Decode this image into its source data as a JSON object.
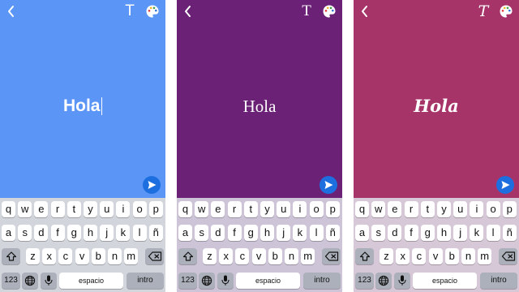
{
  "phones": [
    {
      "background": "#5b96f7",
      "keyboard_bg": "#d2d5dc",
      "font_icon": "T",
      "font_style": "sans",
      "text": "Hola",
      "show_caret": true
    },
    {
      "background": "#6b2276",
      "keyboard_bg": "#cec4d8",
      "font_icon": "T",
      "font_style": "serif",
      "text": "Hola",
      "show_caret": false
    },
    {
      "background": "#a63468",
      "keyboard_bg": "#d7c8d8",
      "font_icon": "T",
      "font_style": "script",
      "text": "Hola",
      "show_caret": false
    }
  ],
  "icons": {
    "back": "chevron-left-icon",
    "font": "text-style-icon",
    "palette": "palette-icon",
    "send": "send-arrow-icon",
    "shift": "shift-arrow-icon",
    "delete": "backspace-icon",
    "globe": "globe-icon",
    "mic": "microphone-icon"
  },
  "keyboard": {
    "row1": [
      "q",
      "w",
      "e",
      "r",
      "t",
      "y",
      "u",
      "i",
      "o",
      "p"
    ],
    "row2": [
      "a",
      "s",
      "d",
      "f",
      "g",
      "h",
      "j",
      "k",
      "l",
      "ñ"
    ],
    "row3": [
      "z",
      "x",
      "c",
      "v",
      "b",
      "n",
      "m"
    ],
    "numbers_label": "123",
    "space_label": "espacio",
    "return_label": "intro"
  },
  "colors": {
    "send_button": "#1d6fe0",
    "key_light": "#ffffff",
    "key_dark": "#abb0ba"
  }
}
